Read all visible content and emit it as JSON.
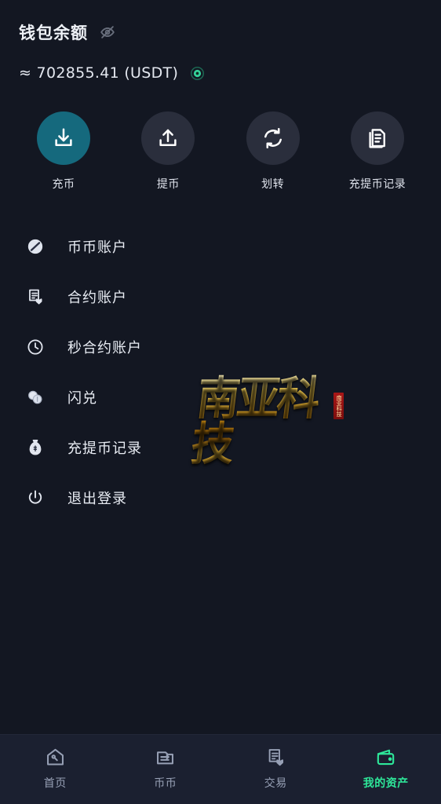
{
  "header": {
    "wallet_title": "钱包余额",
    "visibility_icon": "eye-off-icon",
    "balance_display": "≈ 702855.41 (USDT)",
    "balance_amount": "702855.41",
    "balance_currency": "USDT",
    "balance_prefix": "≈",
    "balance_status_icon": "green-dot-icon"
  },
  "actions": [
    {
      "label": "充币",
      "icon": "download-icon",
      "accent": true
    },
    {
      "label": "提币",
      "icon": "upload-icon",
      "accent": false
    },
    {
      "label": "划转",
      "icon": "transfer-refresh-icon",
      "accent": false
    },
    {
      "label": "充提币记录",
      "icon": "document-list-icon",
      "accent": false
    }
  ],
  "menu": [
    {
      "label": "币币账户",
      "icon": "coin-slash-icon"
    },
    {
      "label": "合约账户",
      "icon": "contract-document-icon"
    },
    {
      "label": "秒合约账户",
      "icon": "clock-icon"
    },
    {
      "label": "闪兑",
      "icon": "two-coins-icon"
    },
    {
      "label": "充提币记录",
      "icon": "money-bag-icon"
    },
    {
      "label": "退出登录",
      "icon": "power-icon"
    }
  ],
  "watermark": {
    "text": "南亚科技",
    "seal_text": "南亚科技"
  },
  "bottom_nav": [
    {
      "label": "首页",
      "icon": "home-icon",
      "active": false
    },
    {
      "label": "币币",
      "icon": "spot-exchange-icon",
      "active": false
    },
    {
      "label": "交易",
      "icon": "trade-document-icon",
      "active": false
    },
    {
      "label": "我的资产",
      "icon": "wallet-icon",
      "active": true
    }
  ],
  "colors": {
    "background": "#131722",
    "nav_background": "#1b2030",
    "accent_teal": "#15697d",
    "circle_gray": "#2a2e3c",
    "active_green": "#2ee89a",
    "text_primary": "#e9edf4",
    "text_muted": "#97a0b5"
  }
}
